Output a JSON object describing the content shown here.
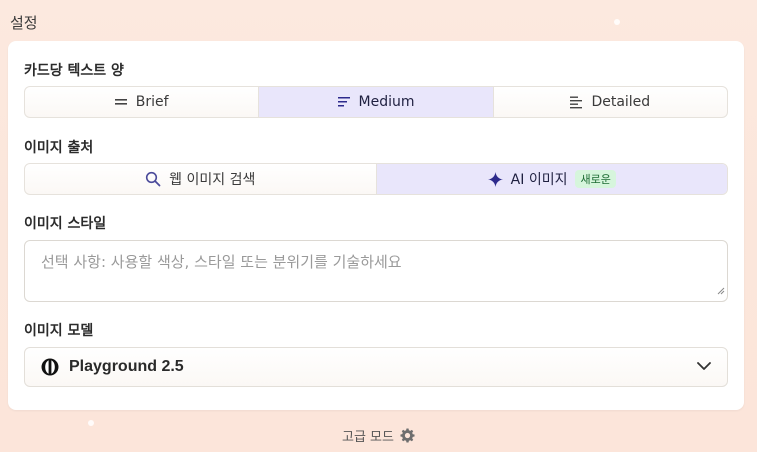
{
  "page": {
    "title": "설정"
  },
  "text_amount": {
    "label": "카드당 텍스트 양",
    "options": [
      {
        "label": "Brief",
        "icon": "short-lines-icon",
        "selected": false
      },
      {
        "label": "Medium",
        "icon": "medium-lines-icon",
        "selected": true
      },
      {
        "label": "Detailed",
        "icon": "detailed-lines-icon",
        "selected": false
      }
    ]
  },
  "image_source": {
    "label": "이미지 출처",
    "options": [
      {
        "label": "웹 이미지 검색",
        "icon": "search-icon",
        "selected": false
      },
      {
        "label": "AI 이미지",
        "icon": "sparkle-icon",
        "selected": true,
        "badge": "새로운"
      }
    ]
  },
  "image_style": {
    "label": "이미지 스타일",
    "value": "",
    "placeholder": "선택 사항: 사용할 색상, 스타일 또는 분위기를 기술하세요"
  },
  "image_model": {
    "label": "이미지 모델",
    "selected": "Playground 2.5",
    "icon": "playground-logo-icon"
  },
  "footer": {
    "advanced_label": "고급 모드",
    "icon": "gear-icon"
  },
  "colors": {
    "accent_bg": "#e9e6fb",
    "accent_icon": "#2d2a8c",
    "badge_bg": "#d6f5dc"
  }
}
